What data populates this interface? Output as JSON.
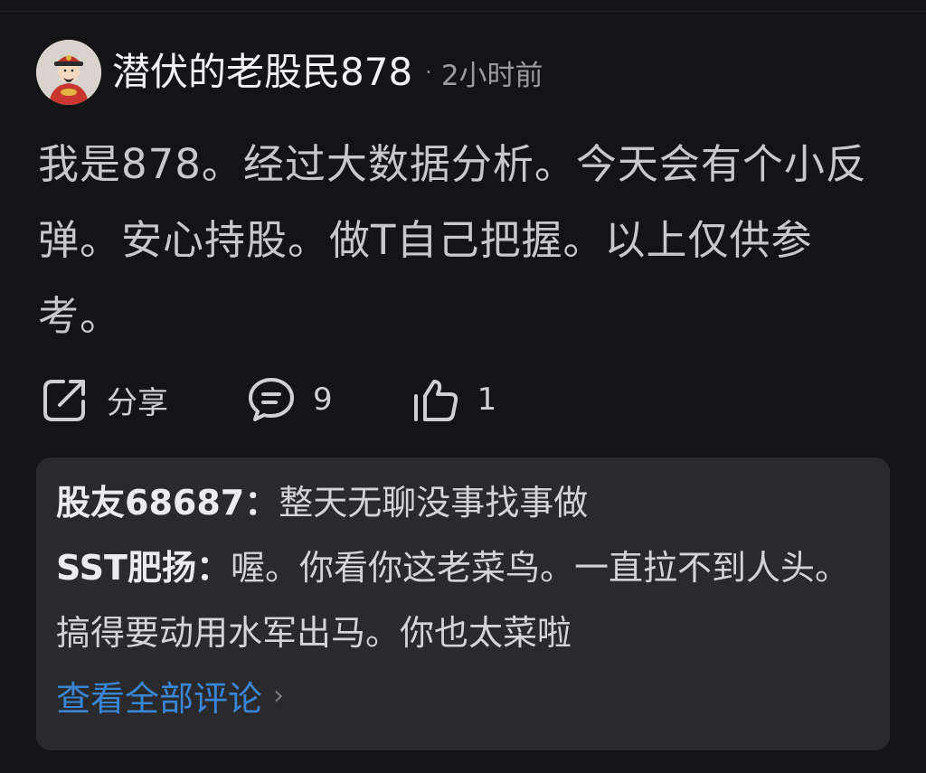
{
  "post": {
    "author": "潜伏的老股民878",
    "separator": "·",
    "time": "2小时前",
    "body": "我是878。经过大数据分析。今天会有个小反弹。安心持股。做T自己把握。以上仅供参考。"
  },
  "actions": {
    "share_label": "分享",
    "comment_count": "9",
    "like_count": "1"
  },
  "comments": [
    {
      "author": "股友68687",
      "separator": "：",
      "text": "整天无聊没事找事做"
    },
    {
      "author": "SST肥扬",
      "separator": "：",
      "text": "喔。你看你这老菜鸟。一直拉不到人头。搞得要动用水军出马。你也太菜啦"
    }
  ],
  "view_all": {
    "label": "查看全部评论",
    "chevron": "›"
  },
  "icons": {
    "avatar": "caishen-avatar",
    "share": "share-icon",
    "comment": "comment-bubble-icon",
    "like": "thumbs-up-icon"
  },
  "colors": {
    "background": "#141416",
    "card": "#2a2a2d",
    "link": "#3a86d6"
  }
}
